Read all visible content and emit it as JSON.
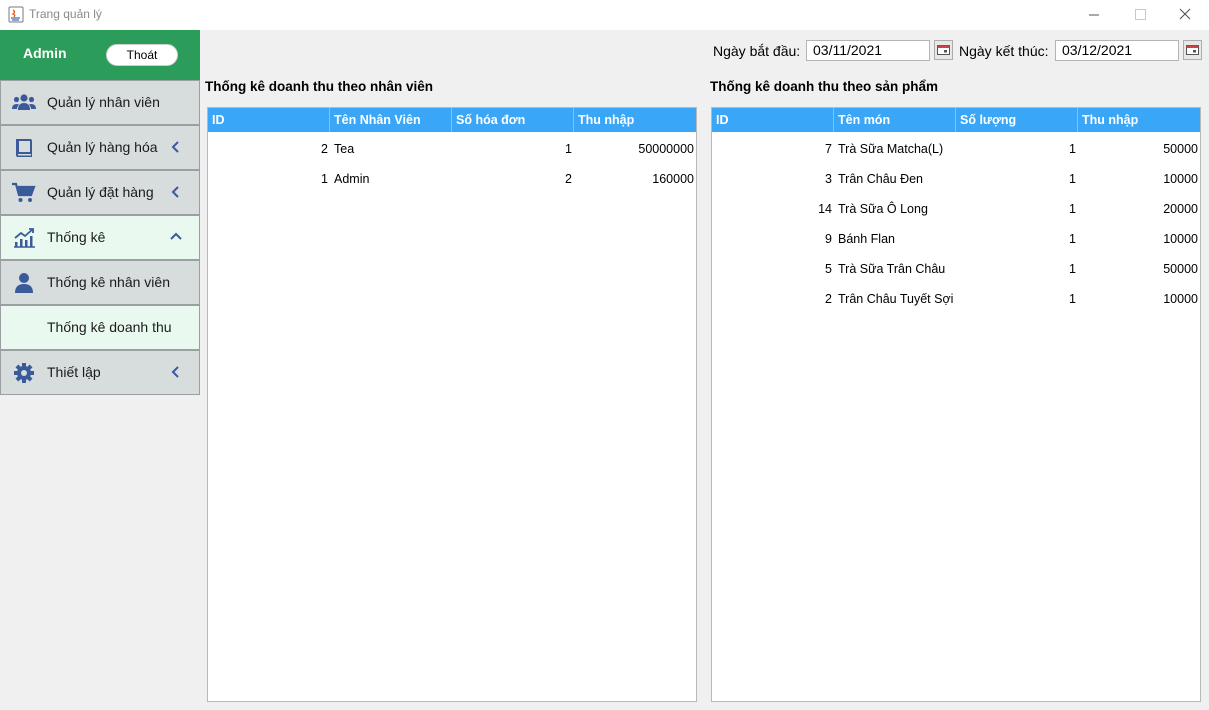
{
  "window": {
    "title": "Trang quản lý"
  },
  "sidebar": {
    "user": "Admin",
    "logout_label": "Thoát",
    "items": [
      {
        "label": "Quản lý nhân viên",
        "icon": "users-icon",
        "chevron": "none"
      },
      {
        "label": "Quản lý hàng hóa",
        "icon": "book-icon",
        "chevron": "left"
      },
      {
        "label": "Quản lý đặt hàng",
        "icon": "cart-icon",
        "chevron": "left"
      },
      {
        "label": "Thống kê",
        "icon": "chart-line-icon",
        "chevron": "up"
      },
      {
        "label": "Thống kê nhân viên",
        "icon": "user-icon",
        "chevron": "none"
      },
      {
        "label": "Thống kê doanh thu",
        "icon": "none",
        "chevron": "none"
      },
      {
        "label": "Thiết lập",
        "icon": "gear-icon",
        "chevron": "left"
      }
    ]
  },
  "filters": {
    "start_label": "Ngày bắt đầu:",
    "start_value": "03/11/2021",
    "end_label": "Ngày kết thúc:",
    "end_value": "03/12/2021"
  },
  "employee_stats": {
    "title": "Thống kê doanh thu theo nhân viên",
    "columns": [
      "ID",
      "Tên Nhân Viên",
      "Số hóa đơn",
      "Thu nhập"
    ],
    "rows": [
      [
        "2",
        "Tea",
        "1",
        "50000000"
      ],
      [
        "1",
        "Admin",
        "2",
        "160000"
      ]
    ]
  },
  "product_stats": {
    "title": "Thống kê doanh thu theo sản phẩm",
    "columns": [
      "ID",
      "Tên món",
      "Số lượng",
      "Thu nhập"
    ],
    "rows": [
      [
        "7",
        "Trà Sữa Matcha(L)",
        "1",
        "50000"
      ],
      [
        "3",
        "Trân Châu Đen",
        "1",
        "10000"
      ],
      [
        "14",
        "Trà Sữa Ô Long",
        "1",
        "20000"
      ],
      [
        "9",
        "Bánh Flan",
        "1",
        "10000"
      ],
      [
        "5",
        "Trà Sữa Trân Châu",
        "1",
        "50000"
      ],
      [
        "2",
        "Trân Châu Tuyết Sợi",
        "1",
        "10000"
      ]
    ]
  },
  "colors": {
    "sidebar_header": "#2c9c5a",
    "table_header": "#3aa6f7",
    "sidebar_item": "#d7dcdd",
    "sidebar_active": "#e9f9ef",
    "icon": "#3b5a9a"
  }
}
